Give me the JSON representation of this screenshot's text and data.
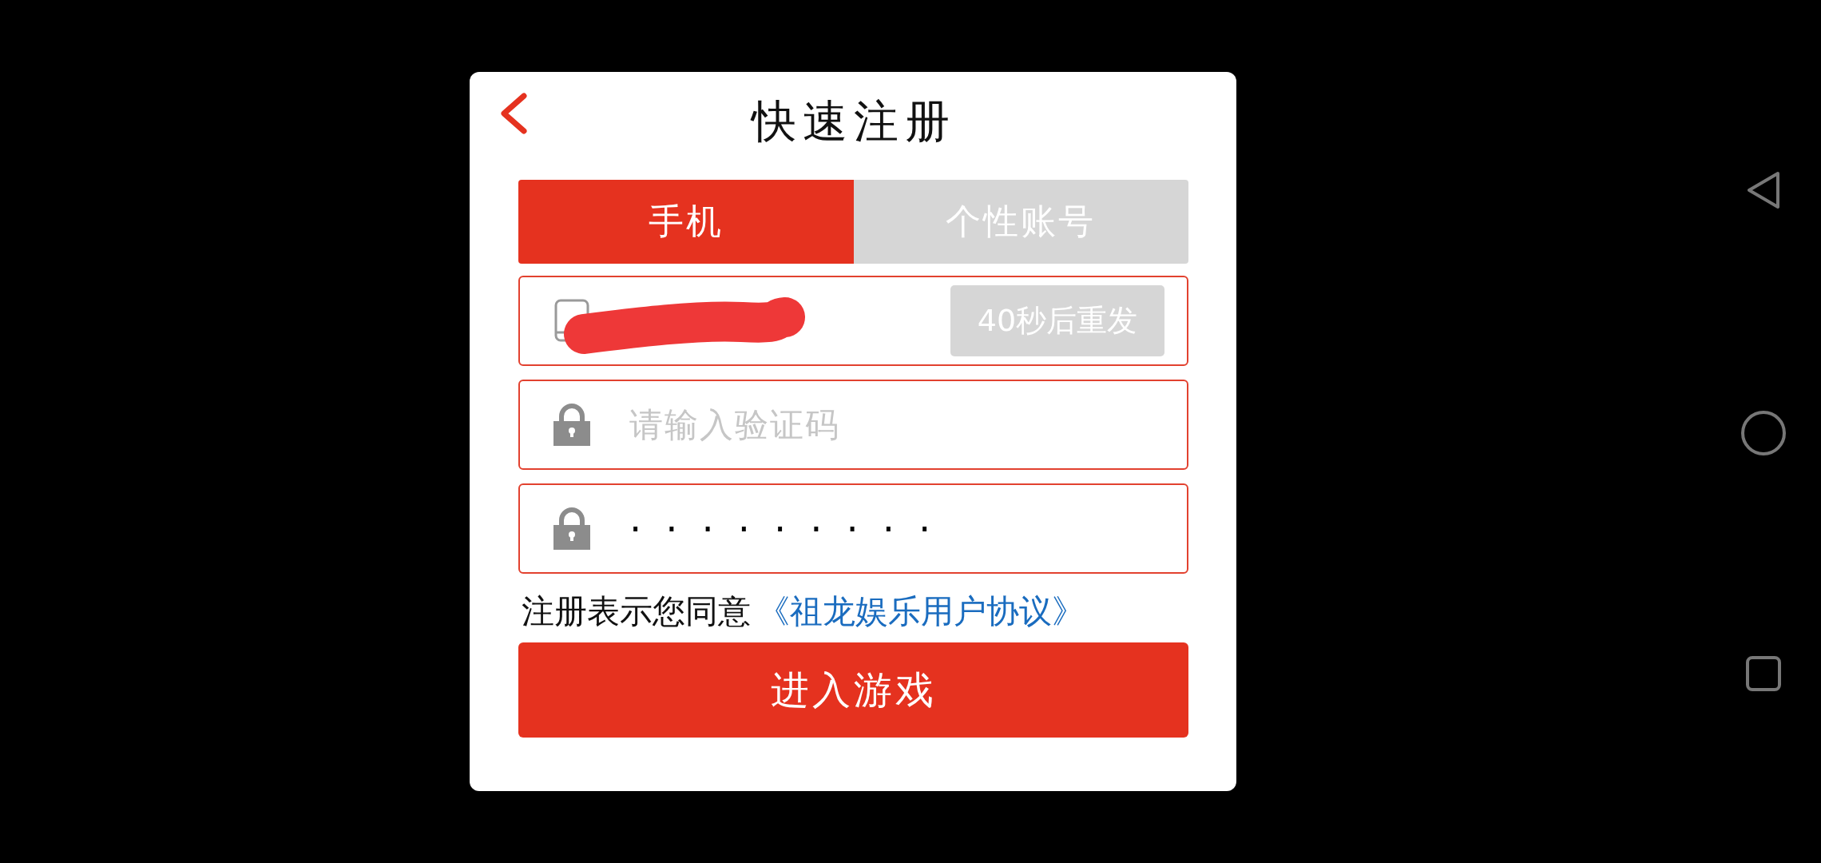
{
  "dialog": {
    "title": "快速注册"
  },
  "tabs": [
    {
      "label": "手机",
      "selected": true
    },
    {
      "label": "个性账号",
      "selected": false
    }
  ],
  "fields": [
    {
      "kind": "phone",
      "redacted": true,
      "resend_button": {
        "label": "40秒后重发",
        "disabled": true
      }
    },
    {
      "kind": "code",
      "placeholder": "请输入验证码"
    },
    {
      "kind": "password",
      "value": "·········"
    }
  ],
  "agreement": {
    "text": "注册表示您同意",
    "link": "《祖龙娱乐用户协议》"
  },
  "submit_button": {
    "label": "进入游戏"
  }
}
